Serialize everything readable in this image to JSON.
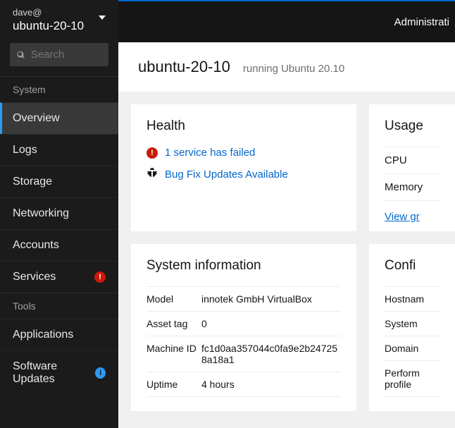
{
  "host": {
    "user": "dave@",
    "name": "ubuntu-20-10"
  },
  "search": {
    "placeholder": "Search"
  },
  "nav": {
    "system_header": "System",
    "items": {
      "overview": "Overview",
      "logs": "Logs",
      "storage": "Storage",
      "networking": "Networking",
      "accounts": "Accounts",
      "services": "Services"
    },
    "tools_header": "Tools",
    "tool_items": {
      "applications": "Applications",
      "software_updates": "Software Updates"
    }
  },
  "topbar": {
    "admin": "Administrati"
  },
  "page": {
    "title": "ubuntu-20-10",
    "subtitle": "running Ubuntu 20.10"
  },
  "health": {
    "title": "Health",
    "failed": "1 service has failed",
    "bugfix": "Bug Fix Updates Available"
  },
  "usage": {
    "title": "Usage",
    "cpu": "CPU",
    "memory": "Memory",
    "view": "View gr"
  },
  "sysinfo": {
    "title": "System information",
    "rows": {
      "model_k": "Model",
      "model_v": "innotek GmbH VirtualBox",
      "asset_k": "Asset tag",
      "asset_v": "0",
      "machine_k": "Machine ID",
      "machine_v": "fc1d0aa357044c0fa9e2b247258a18a1",
      "uptime_k": "Uptime",
      "uptime_v": "4 hours"
    }
  },
  "config": {
    "title": "Confi",
    "rows": {
      "hostname_k": "Hostnam",
      "systime_k": "System ",
      "domain_k": "Domain",
      "perf_k": "Perform",
      "perf_k2": "profile"
    }
  }
}
